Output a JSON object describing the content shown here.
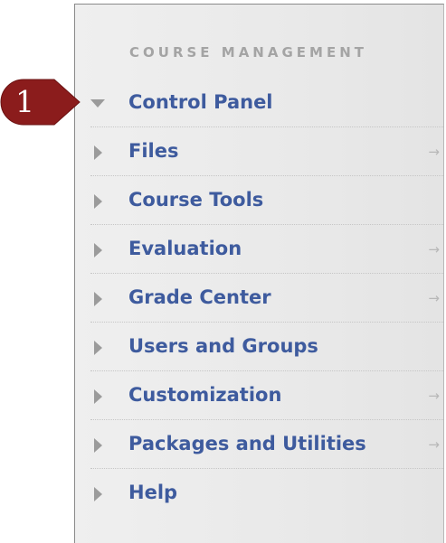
{
  "course_management": {
    "section_title": "COURSE MANAGEMENT",
    "items": [
      {
        "label": "Control Panel",
        "expanded": true,
        "has_arrow": false
      },
      {
        "label": "Files",
        "expanded": false,
        "has_arrow": true,
        "arrow": "→"
      },
      {
        "label": "Course Tools",
        "expanded": false,
        "has_arrow": false
      },
      {
        "label": "Evaluation",
        "expanded": false,
        "has_arrow": true,
        "arrow": "→"
      },
      {
        "label": "Grade Center",
        "expanded": false,
        "has_arrow": true,
        "arrow": "→"
      },
      {
        "label": "Users and Groups",
        "expanded": false,
        "has_arrow": false
      },
      {
        "label": "Customization",
        "expanded": false,
        "has_arrow": true,
        "arrow": "→"
      },
      {
        "label": "Packages and Utilities",
        "expanded": false,
        "has_arrow": true,
        "arrow": "→"
      },
      {
        "label": "Help",
        "expanded": false,
        "has_arrow": false
      }
    ]
  },
  "callout": {
    "number": "1",
    "color": "#8b1c1c"
  },
  "icons": {
    "expanded": "triangle-down-icon",
    "collapsed": "triangle-right-icon",
    "link": "arrow-right-icon"
  },
  "colors": {
    "link": "#3e5b9e",
    "section_title": "#a4a4a4",
    "triangle": "#9b9b9b",
    "panel_bg": "#ececec"
  }
}
